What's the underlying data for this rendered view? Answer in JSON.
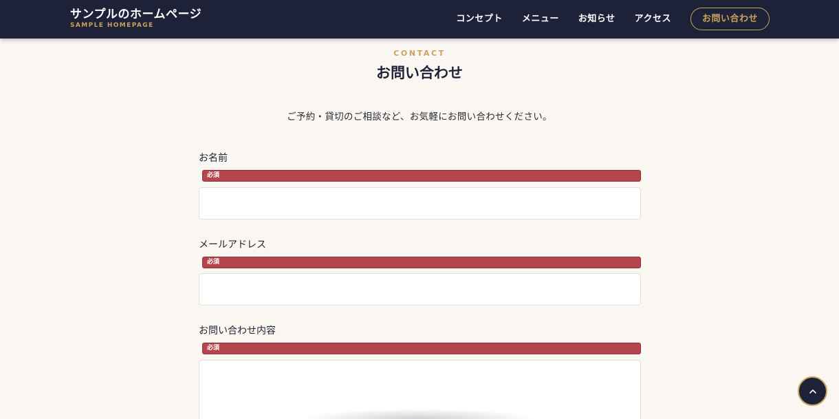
{
  "header": {
    "logo_title": "サンプルのホームページ",
    "logo_subtitle": "SAMPLE HOMEPAGE",
    "nav": [
      {
        "label": "コンセプト"
      },
      {
        "label": "メニュー"
      },
      {
        "label": "お知らせ"
      },
      {
        "label": "アクセス"
      }
    ],
    "cta_label": "お問い合わせ"
  },
  "section": {
    "eyebrow": "CONTACT",
    "title": "お問い合わせ",
    "lead": "ご予約・貸切のご相談など、お気軽にお問い合わせください。"
  },
  "form": {
    "fields": [
      {
        "label": "お名前",
        "required_badge": "必須",
        "value": ""
      },
      {
        "label": "メールアドレス",
        "required_badge": "必須",
        "value": ""
      },
      {
        "label": "お問い合わせ内容",
        "required_badge": "必須",
        "value": ""
      }
    ]
  },
  "colors": {
    "header_bg": "#1d2238",
    "accent_gold": "#c9a25c",
    "required_red": "#b5464e",
    "page_bg": "#faf7f2"
  },
  "icons": {
    "back_to_top": "chevron-up-icon"
  }
}
